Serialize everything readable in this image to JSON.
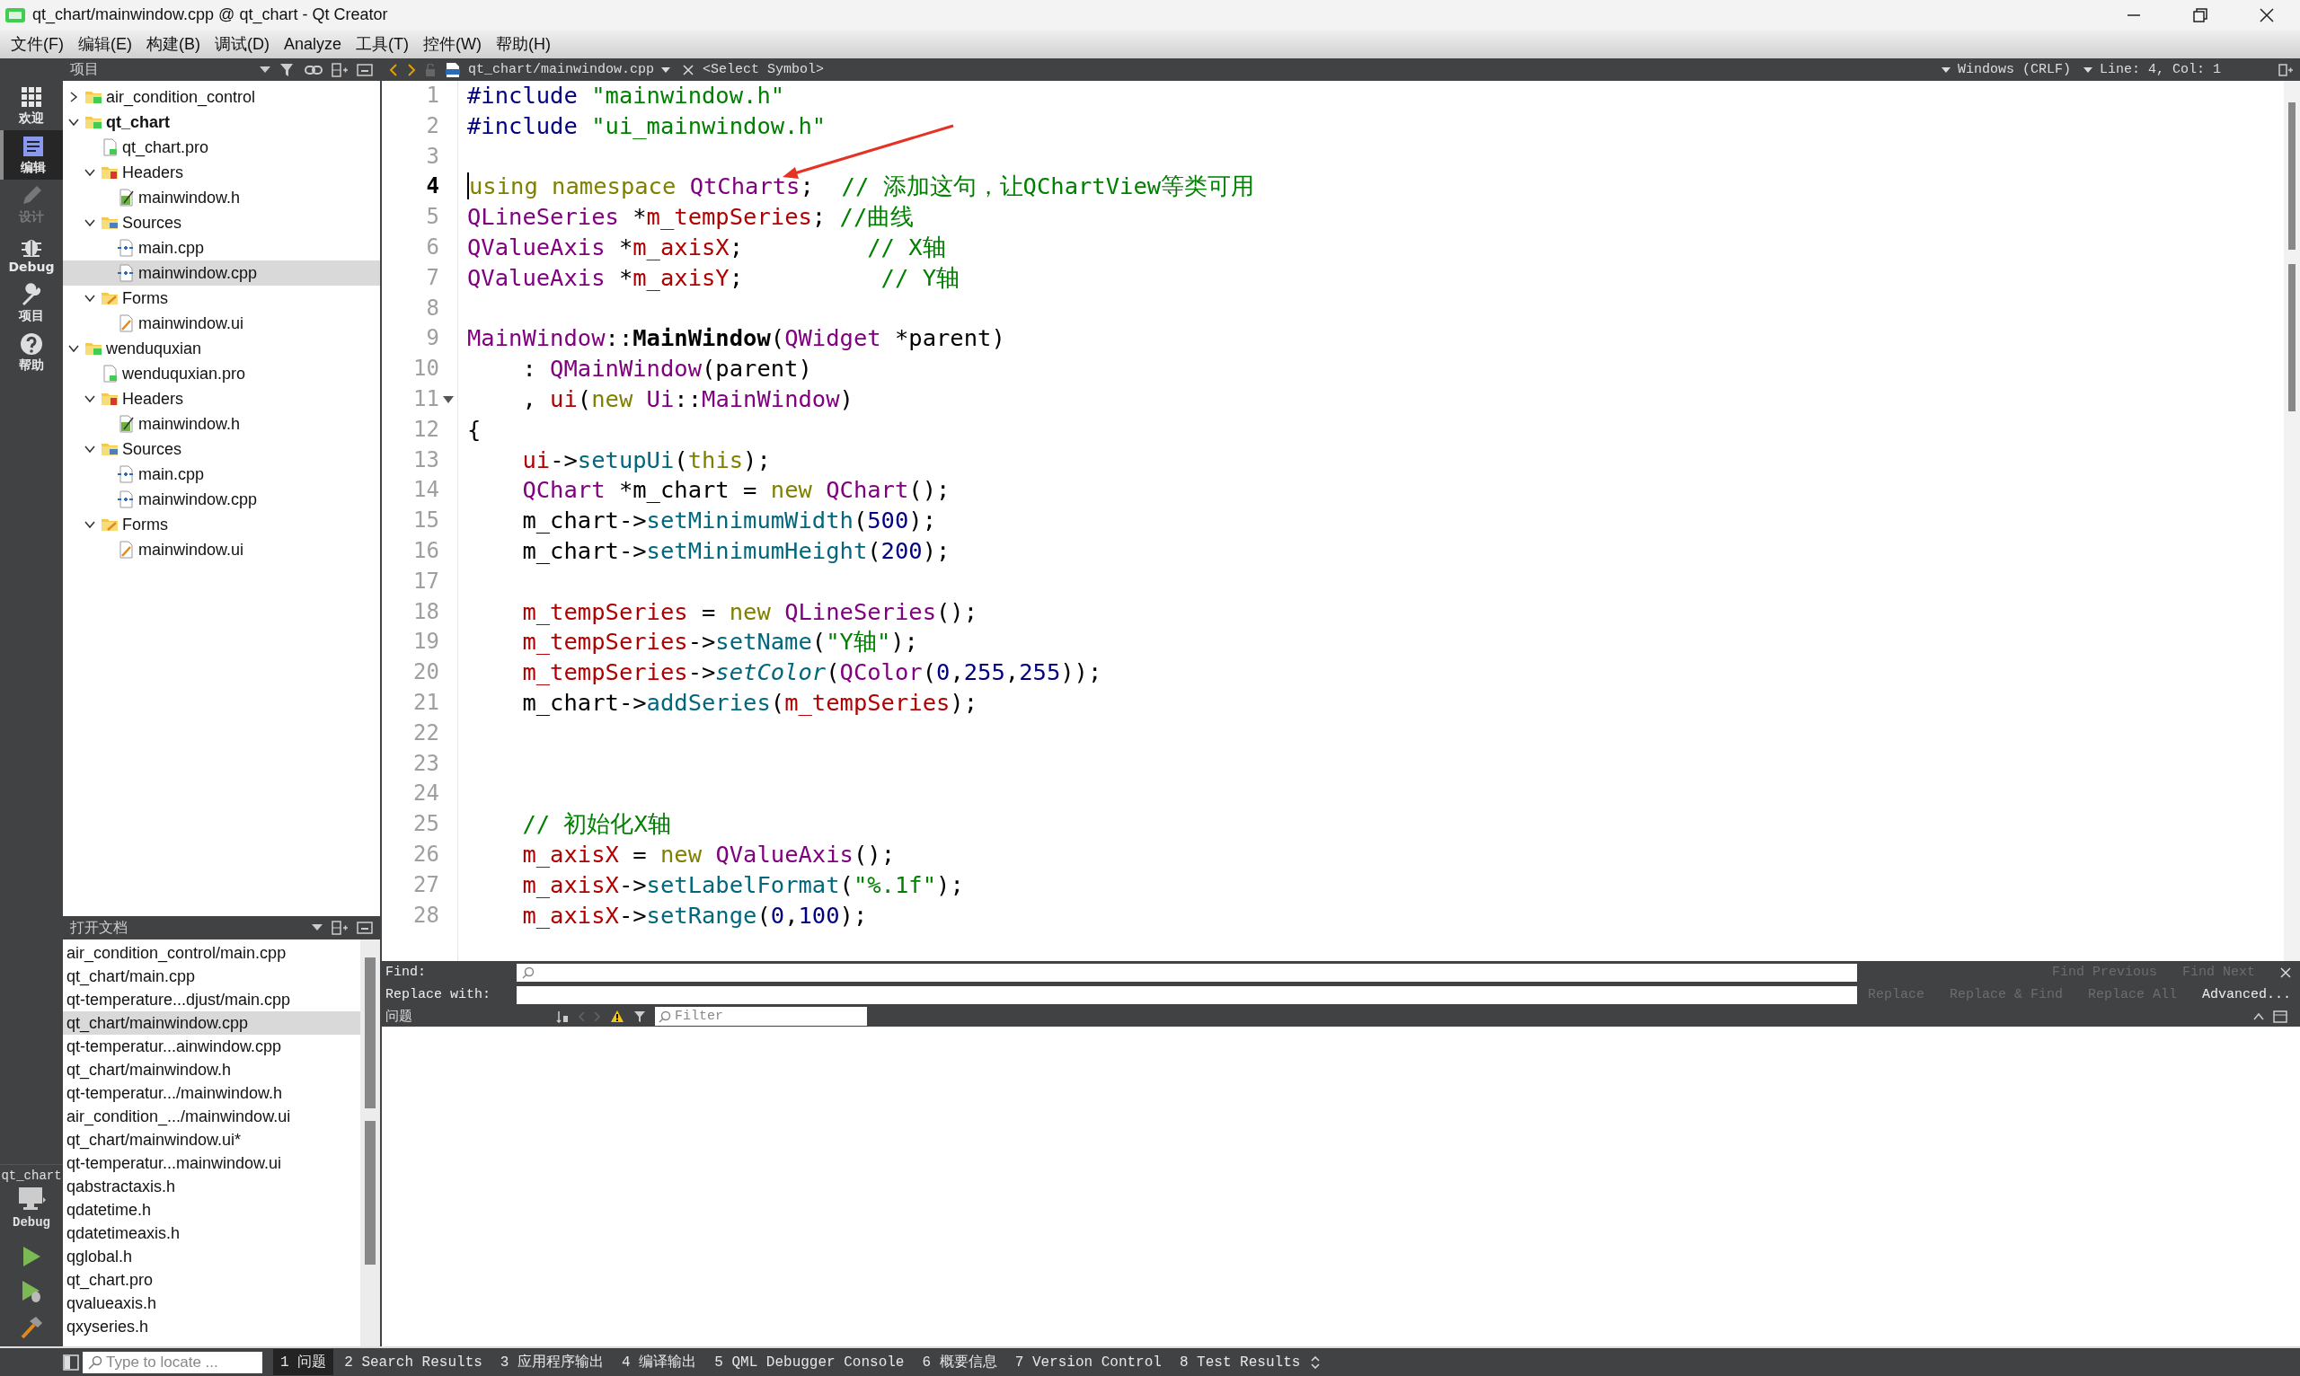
{
  "window": {
    "title": "qt_chart/mainwindow.cpp @ qt_chart - Qt Creator"
  },
  "menu": [
    "文件(F)",
    "编辑(E)",
    "构建(B)",
    "调试(D)",
    "Analyze",
    "工具(T)",
    "控件(W)",
    "帮助(H)"
  ],
  "mode_bar": {
    "modes": [
      {
        "label": "欢迎",
        "kind": "welcome",
        "selected": false,
        "disabled": false
      },
      {
        "label": "编辑",
        "kind": "edit",
        "selected": true,
        "disabled": false
      },
      {
        "label": "设计",
        "kind": "design",
        "selected": false,
        "disabled": true
      },
      {
        "label": "Debug",
        "kind": "debug",
        "selected": false,
        "disabled": false
      },
      {
        "label": "项目",
        "kind": "projects",
        "selected": false,
        "disabled": false
      },
      {
        "label": "帮助",
        "kind": "help",
        "selected": false,
        "disabled": false
      }
    ],
    "kit": {
      "project": "qt_chart",
      "build": "Debug"
    }
  },
  "project_panel": {
    "title": "项目",
    "tree": [
      {
        "label": "air_condition_control",
        "kind": "project",
        "active": false,
        "selected": false,
        "expanded": false
      },
      {
        "label": "qt_chart",
        "kind": "project",
        "active": true,
        "selected": false,
        "expanded": true,
        "children": [
          {
            "label": "qt_chart.pro",
            "kind": "pro",
            "selected": false
          },
          {
            "label": "Headers",
            "kind": "headers",
            "selected": false,
            "expanded": true,
            "children": [
              {
                "label": "mainwindow.h",
                "kind": "h",
                "selected": false
              }
            ]
          },
          {
            "label": "Sources",
            "kind": "sources",
            "selected": false,
            "expanded": true,
            "children": [
              {
                "label": "main.cpp",
                "kind": "cpp",
                "selected": false
              },
              {
                "label": "mainwindow.cpp",
                "kind": "cpp",
                "selected": true
              }
            ]
          },
          {
            "label": "Forms",
            "kind": "forms",
            "selected": false,
            "expanded": true,
            "children": [
              {
                "label": "mainwindow.ui",
                "kind": "ui",
                "selected": false
              }
            ]
          }
        ]
      },
      {
        "label": "wenduquxian",
        "kind": "project",
        "active": false,
        "selected": false,
        "expanded": true,
        "children": [
          {
            "label": "wenduquxian.pro",
            "kind": "pro",
            "selected": false
          },
          {
            "label": "Headers",
            "kind": "headers",
            "selected": false,
            "expanded": true,
            "children": [
              {
                "label": "mainwindow.h",
                "kind": "h",
                "selected": false
              }
            ]
          },
          {
            "label": "Sources",
            "kind": "sources",
            "selected": false,
            "expanded": true,
            "children": [
              {
                "label": "main.cpp",
                "kind": "cpp",
                "selected": false
              },
              {
                "label": "mainwindow.cpp",
                "kind": "cpp",
                "selected": false
              }
            ]
          },
          {
            "label": "Forms",
            "kind": "forms",
            "selected": false,
            "expanded": true,
            "children": [
              {
                "label": "mainwindow.ui",
                "kind": "ui",
                "selected": false
              }
            ]
          }
        ]
      }
    ]
  },
  "open_documents": {
    "title": "打开文档",
    "items": [
      {
        "label": "air_condition_control/main.cpp",
        "selected": false
      },
      {
        "label": "qt_chart/main.cpp",
        "selected": false
      },
      {
        "label": "qt-temperature...djust/main.cpp",
        "selected": false
      },
      {
        "label": "qt_chart/mainwindow.cpp",
        "selected": true
      },
      {
        "label": "qt-temperatur...ainwindow.cpp",
        "selected": false
      },
      {
        "label": "qt_chart/mainwindow.h",
        "selected": false
      },
      {
        "label": "qt-temperatur.../mainwindow.h",
        "selected": false
      },
      {
        "label": "air_condition_.../mainwindow.ui",
        "selected": false
      },
      {
        "label": "qt_chart/mainwindow.ui*",
        "selected": false
      },
      {
        "label": "qt-temperatur...mainwindow.ui",
        "selected": false
      },
      {
        "label": "qabstractaxis.h",
        "selected": false
      },
      {
        "label": "qdatetime.h",
        "selected": false
      },
      {
        "label": "qdatetimeaxis.h",
        "selected": false
      },
      {
        "label": "qglobal.h",
        "selected": false
      },
      {
        "label": "qt_chart.pro",
        "selected": false
      },
      {
        "label": "qvalueaxis.h",
        "selected": false
      },
      {
        "label": "qxyseries.h",
        "selected": false
      }
    ]
  },
  "editor": {
    "file": "qt_chart/mainwindow.cpp",
    "symbol": "<Select Symbol>",
    "line_ending": "Windows (CRLF)",
    "position": "Line: 4, Col: 1",
    "lines": [
      {
        "number": "1",
        "current": false,
        "tokens": [
          {
            "kind": "pre",
            "text": "#include"
          },
          {
            "kind": "str",
            "text": " \"mainwindow.h\""
          }
        ]
      },
      {
        "number": "2",
        "current": false,
        "tokens": [
          {
            "kind": "pre",
            "text": "#include"
          },
          {
            "kind": "str",
            "text": " \"ui_mainwindow.h\""
          }
        ]
      },
      {
        "number": "3",
        "current": false
      },
      {
        "number": "4",
        "current": true,
        "tokens": [
          {
            "kind": "kw",
            "text": "using"
          },
          {
            "kind": "kw",
            "text": " namespace"
          },
          {
            "kind": "type",
            "text": " QtCharts"
          },
          {
            "kind": "text",
            "text": ";"
          },
          {
            "kind": "cmt",
            "text": "  // 添加这句，让QChartView等类可用"
          }
        ]
      },
      {
        "number": "5",
        "current": false,
        "tokens": [
          {
            "kind": "type",
            "text": "QLineSeries"
          },
          {
            "kind": "text",
            "text": " *"
          },
          {
            "kind": "field",
            "text": "m_tempSeries"
          },
          {
            "kind": "text",
            "text": ";"
          },
          {
            "kind": "cmt",
            "text": " //曲线"
          }
        ]
      },
      {
        "number": "6",
        "current": false,
        "tokens": [
          {
            "kind": "type",
            "text": "QValueAxis"
          },
          {
            "kind": "text",
            "text": " *"
          },
          {
            "kind": "field",
            "text": "m_axisX"
          },
          {
            "kind": "text",
            "text": ";"
          },
          {
            "kind": "cmt",
            "text": "         // X轴"
          }
        ]
      },
      {
        "number": "7",
        "current": false,
        "tokens": [
          {
            "kind": "type",
            "text": "QValueAxis"
          },
          {
            "kind": "text",
            "text": " *"
          },
          {
            "kind": "field",
            "text": "m_axisY"
          },
          {
            "kind": "text",
            "text": ";"
          },
          {
            "kind": "cmt",
            "text": "          // Y轴"
          }
        ]
      },
      {
        "number": "8",
        "current": false
      },
      {
        "number": "9",
        "current": false,
        "tokens": [
          {
            "kind": "type",
            "text": "MainWindow"
          },
          {
            "kind": "text",
            "text": "::"
          },
          {
            "kind": "fnb",
            "text": "MainWindow"
          },
          {
            "kind": "text",
            "text": "("
          },
          {
            "kind": "type",
            "text": "QWidget"
          },
          {
            "kind": "text",
            "text": " *parent)"
          }
        ]
      },
      {
        "number": "10",
        "current": false,
        "tokens": [
          {
            "kind": "text",
            "text": "    :"
          },
          {
            "kind": "type",
            "text": " QMainWindow"
          },
          {
            "kind": "text",
            "text": "(parent)"
          }
        ]
      },
      {
        "number": "11",
        "current": false,
        "foldable": true,
        "tokens": [
          {
            "kind": "text",
            "text": "    ,"
          },
          {
            "kind": "field",
            "text": " ui"
          },
          {
            "kind": "text",
            "text": "("
          },
          {
            "kind": "kw",
            "text": "new"
          },
          {
            "kind": "type",
            "text": " Ui"
          },
          {
            "kind": "text",
            "text": "::"
          },
          {
            "kind": "type",
            "text": "MainWindow"
          },
          {
            "kind": "text",
            "text": ")"
          }
        ]
      },
      {
        "number": "12",
        "current": false,
        "tokens": [
          {
            "kind": "text",
            "text": "{"
          }
        ]
      },
      {
        "number": "13",
        "current": false,
        "tokens": [
          {
            "kind": "field",
            "text": "    ui"
          },
          {
            "kind": "text",
            "text": "->"
          },
          {
            "kind": "fn",
            "text": "setupUi"
          },
          {
            "kind": "text",
            "text": "("
          },
          {
            "kind": "kw",
            "text": "this"
          },
          {
            "kind": "text",
            "text": ");"
          }
        ]
      },
      {
        "number": "14",
        "current": false,
        "tokens": [
          {
            "kind": "type",
            "text": "    QChart"
          },
          {
            "kind": "text",
            "text": " *m_chart ="
          },
          {
            "kind": "kw",
            "text": " new"
          },
          {
            "kind": "type",
            "text": " QChart"
          },
          {
            "kind": "text",
            "text": "();"
          }
        ]
      },
      {
        "number": "15",
        "current": false,
        "tokens": [
          {
            "kind": "text",
            "text": "    m_chart->"
          },
          {
            "kind": "fn",
            "text": "setMinimumWidth"
          },
          {
            "kind": "text",
            "text": "("
          },
          {
            "kind": "num",
            "text": "500"
          },
          {
            "kind": "text",
            "text": ");"
          }
        ]
      },
      {
        "number": "16",
        "current": false,
        "tokens": [
          {
            "kind": "text",
            "text": "    m_chart->"
          },
          {
            "kind": "fn",
            "text": "setMinimumHeight"
          },
          {
            "kind": "text",
            "text": "("
          },
          {
            "kind": "num",
            "text": "200"
          },
          {
            "kind": "text",
            "text": ");"
          }
        ]
      },
      {
        "number": "17",
        "current": false
      },
      {
        "number": "18",
        "current": false,
        "tokens": [
          {
            "kind": "field",
            "text": "    m_tempSeries"
          },
          {
            "kind": "text",
            "text": " ="
          },
          {
            "kind": "kw",
            "text": " new"
          },
          {
            "kind": "type",
            "text": " QLineSeries"
          },
          {
            "kind": "text",
            "text": "();"
          }
        ]
      },
      {
        "number": "19",
        "current": false,
        "tokens": [
          {
            "kind": "field",
            "text": "    m_tempSeries"
          },
          {
            "kind": "text",
            "text": "->"
          },
          {
            "kind": "fn",
            "text": "setName"
          },
          {
            "kind": "text",
            "text": "("
          },
          {
            "kind": "str",
            "text": "\"Y轴\""
          },
          {
            "kind": "text",
            "text": ");"
          }
        ]
      },
      {
        "number": "20",
        "current": false,
        "tokens": [
          {
            "kind": "field",
            "text": "    m_tempSeries"
          },
          {
            "kind": "text",
            "text": "->"
          },
          {
            "kind": "fni",
            "text": "setColor"
          },
          {
            "kind": "text",
            "text": "("
          },
          {
            "kind": "type",
            "text": "QColor"
          },
          {
            "kind": "text",
            "text": "("
          },
          {
            "kind": "num",
            "text": "0"
          },
          {
            "kind": "text",
            "text": ","
          },
          {
            "kind": "num",
            "text": "255"
          },
          {
            "kind": "text",
            "text": ","
          },
          {
            "kind": "num",
            "text": "255"
          },
          {
            "kind": "text",
            "text": "));"
          }
        ]
      },
      {
        "number": "21",
        "current": false,
        "tokens": [
          {
            "kind": "text",
            "text": "    m_chart->"
          },
          {
            "kind": "fn",
            "text": "addSeries"
          },
          {
            "kind": "text",
            "text": "("
          },
          {
            "kind": "field",
            "text": "m_tempSeries"
          },
          {
            "kind": "text",
            "text": ");"
          }
        ]
      },
      {
        "number": "22",
        "current": false
      },
      {
        "number": "23",
        "current": false
      },
      {
        "number": "24",
        "current": false
      },
      {
        "number": "25",
        "current": false,
        "tokens": [
          {
            "kind": "cmt",
            "text": "    // 初始化X轴"
          }
        ]
      },
      {
        "number": "26",
        "current": false,
        "tokens": [
          {
            "kind": "field",
            "text": "    m_axisX"
          },
          {
            "kind": "text",
            "text": " ="
          },
          {
            "kind": "kw",
            "text": " new"
          },
          {
            "kind": "type",
            "text": " QValueAxis"
          },
          {
            "kind": "text",
            "text": "();"
          }
        ]
      },
      {
        "number": "27",
        "current": false,
        "tokens": [
          {
            "kind": "field",
            "text": "    m_axisX"
          },
          {
            "kind": "text",
            "text": "->"
          },
          {
            "kind": "fn",
            "text": "setLabelFormat"
          },
          {
            "kind": "text",
            "text": "("
          },
          {
            "kind": "str",
            "text": "\"%.1f\""
          },
          {
            "kind": "text",
            "text": ");"
          }
        ]
      },
      {
        "number": "28",
        "current": false,
        "tokens": [
          {
            "kind": "field",
            "text": "    m_axisX"
          },
          {
            "kind": "text",
            "text": "->"
          },
          {
            "kind": "fn",
            "text": "setRange"
          },
          {
            "kind": "text",
            "text": "("
          },
          {
            "kind": "num",
            "text": "0"
          },
          {
            "kind": "text",
            "text": ","
          },
          {
            "kind": "num",
            "text": "100"
          },
          {
            "kind": "text",
            "text": ");"
          }
        ]
      }
    ]
  },
  "find_bar": {
    "find_label": "Find:",
    "replace_label": "Replace with:",
    "find_buttons": [
      {
        "label": "Find Previous",
        "disabled": true
      },
      {
        "label": "Find Next",
        "disabled": true
      }
    ],
    "replace_buttons": [
      {
        "label": "Replace",
        "disabled": true
      },
      {
        "label": "Replace & Find",
        "disabled": true
      },
      {
        "label": "Replace All",
        "disabled": true
      },
      {
        "label": "Advanced...",
        "disabled": false
      }
    ]
  },
  "issues": {
    "title": "问题",
    "filter": {
      "placeholder": "Filter"
    }
  },
  "status_bar": {
    "locate": {
      "placeholder": "Type to locate ..."
    },
    "panes": [
      {
        "label": "1 问题",
        "selected": true
      },
      {
        "label": "2 Search Results",
        "selected": false
      },
      {
        "label": "3 应用程序输出",
        "selected": false
      },
      {
        "label": "4 编译输出",
        "selected": false
      },
      {
        "label": "5 QML Debugger Console",
        "selected": false
      },
      {
        "label": "6 概要信息",
        "selected": false
      },
      {
        "label": "7 Version Control",
        "selected": false
      },
      {
        "label": "8 Test Results",
        "selected": false
      }
    ]
  }
}
